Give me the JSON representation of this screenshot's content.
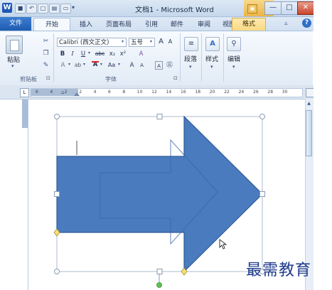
{
  "window": {
    "title": "文档1 - Microsoft Word",
    "app_icon_letter": "W",
    "qat_undo": "↶",
    "qat_dropdown": "▾",
    "minimize": "—",
    "maximize": "□",
    "close": "✕"
  },
  "tabs": {
    "file": "文件",
    "home": "开始",
    "insert": "插入",
    "page_layout": "页面布局",
    "references": "引用",
    "mailings": "邮件",
    "review": "审阅",
    "view": "视图",
    "format": "格式",
    "collapse": "▵",
    "help": "?"
  },
  "ribbon": {
    "clipboard": {
      "paste": "粘贴",
      "paste_arrow": "▾",
      "group_label": "剪贴板",
      "expander": "⊡"
    },
    "font": {
      "font_name": "Calibri (西文正文)",
      "font_size": "五号",
      "grow": "A",
      "shrink": "A",
      "bold": "B",
      "italic": "I",
      "underline": "U",
      "strikethrough": "abc",
      "subscript": "x₂",
      "superscript": "x²",
      "clear": "A",
      "highlight": "ab",
      "font_color": "A",
      "case": "Aa",
      "group_label": "字体",
      "expander": "⊡"
    },
    "paragraph": {
      "label": "段落",
      "arrow": "▾"
    },
    "styles": {
      "label": "样式",
      "arrow": "▾"
    },
    "editing": {
      "label": "编辑",
      "arrow": "▾"
    }
  },
  "ruler": {
    "ticks": [
      "6",
      "4",
      "2",
      "2",
      "4",
      "6",
      "8",
      "10",
      "12",
      "14",
      "16",
      "18",
      "20",
      "22",
      "24",
      "26",
      "28",
      "30"
    ]
  },
  "watermark": "最需教育",
  "colors": {
    "arrow_fill": "#4a7bbf",
    "arrow_outline": "#2f5b97",
    "handle_fill": "#ffffff",
    "handle_stroke": "#8a9bb0",
    "adjust_handle": "#f5e27a",
    "rotate_handle": "#5cc34e"
  }
}
